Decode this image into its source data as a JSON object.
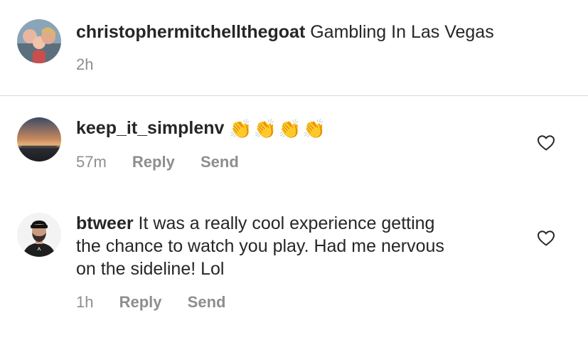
{
  "caption": {
    "username": "christophermitchellthegoat",
    "text": "Gambling In Las Vegas",
    "time": "2h"
  },
  "comments": [
    {
      "username": "keep_it_simplenv",
      "text": "👏👏👏👏",
      "time": "57m",
      "reply_label": "Reply",
      "send_label": "Send"
    },
    {
      "username": "btweer",
      "text_line1": "It was a really cool experience getting",
      "text_line2": "the chance to watch you play. Had me nervous",
      "text_line3": "on the sideline! Lol",
      "time": "1h",
      "reply_label": "Reply",
      "send_label": "Send"
    }
  ],
  "colors": {
    "text": "#262626",
    "secondary": "#8e8e8e",
    "divider": "#dbdbdb"
  }
}
